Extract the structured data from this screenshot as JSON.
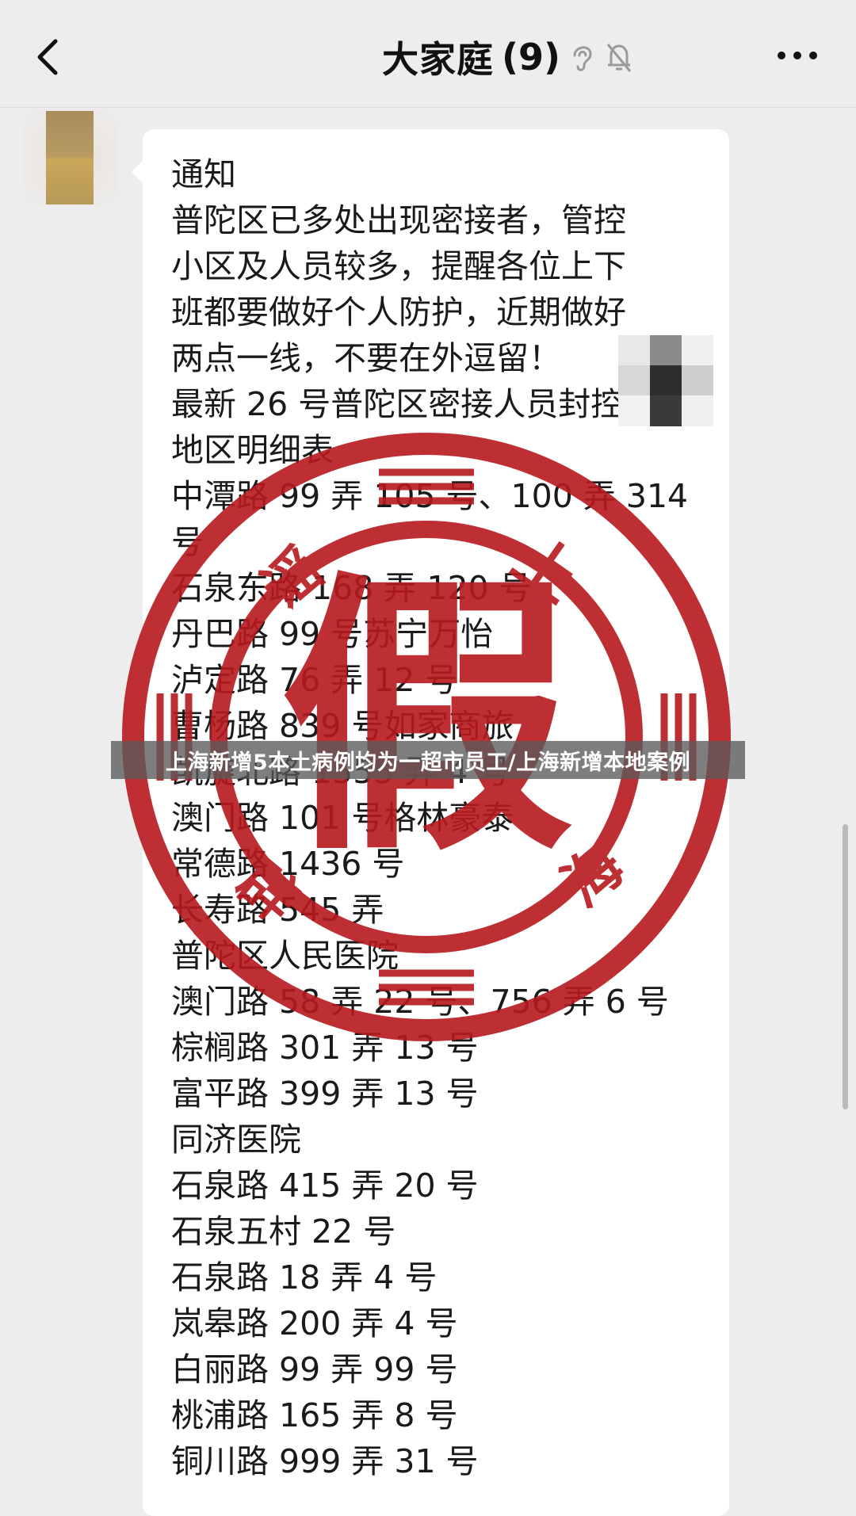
{
  "header": {
    "back_icon": "chevron-left-icon",
    "chat_name": "大家庭",
    "member_count": "(9)",
    "ear_icon": "ear-icon",
    "mute_icon": "bell-muted-icon",
    "more_icon": "more-dots-icon"
  },
  "message": {
    "lines": [
      "通知",
      "普陀区已多处出现密接者，管控",
      "小区及人员较多，提醒各位上下",
      "班都要做好个人防护，近期做好",
      "两点一线，不要在外逗留！",
      "最新 26 号普陀区密接人员封控",
      "地区明细表",
      "中潭路 99 弄 105 号、100 弄 314",
      "号",
      "石泉东路 168 弄 120 号",
      "丹巴路 99 号苏宁万怡",
      "泸定路 76 弄 12 号",
      "曹杨路 839 号如家商旅",
      "凯旋北路 1555 弄 4 号",
      "澳门路 101 号格林豪泰",
      "常德路 1436 号",
      "长寿路 545 弄",
      "普陀区人民医院",
      "澳门路 58 弄 22 号、756 弄 6 号",
      "棕榈路 301 弄 13 号",
      "富平路 399 弄 13 号",
      "同济医院",
      "石泉路 415 弄 20 号",
      "石泉五村 22 号",
      "石泉路 18 弄 4 号",
      "岚皋路 200 弄 4 号",
      "白丽路 99 弄 99 号",
      "桃浦路 165 弄 8 号",
      "铜川路 999 弄 31 号"
    ]
  },
  "stamp": {
    "center_char": "假",
    "top_char": "上",
    "right_char": "海",
    "left_char": "谣",
    "bottom_char": "辟",
    "color": "#b8191e"
  },
  "caption": {
    "text": "上海新增5本土病例均为一超市员工/上海新增本地案例"
  }
}
